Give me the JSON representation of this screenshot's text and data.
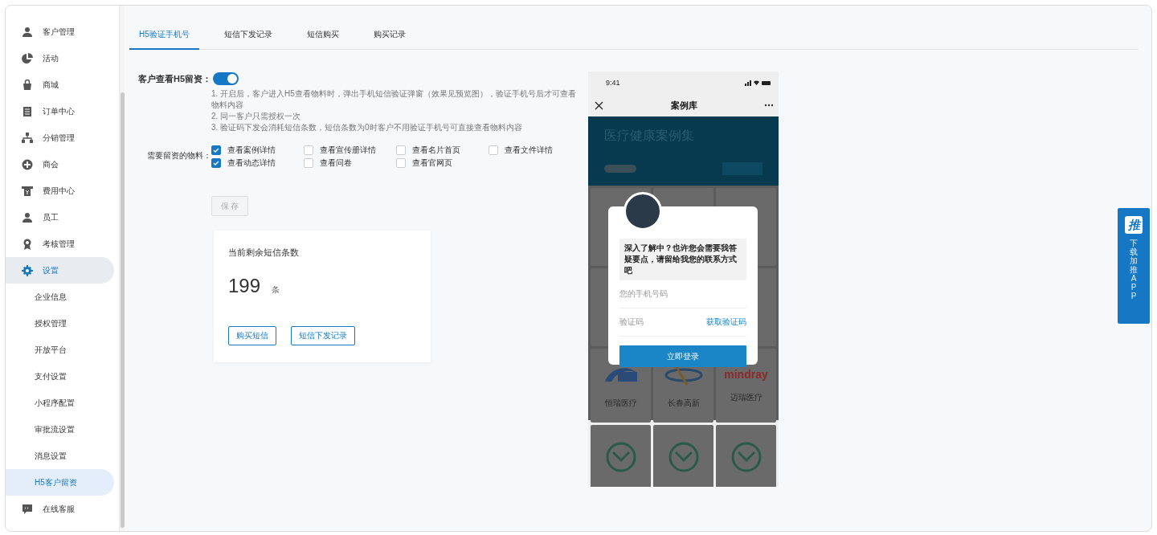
{
  "sidebar": {
    "items": [
      {
        "label": "客户管理",
        "selected": false
      },
      {
        "label": "活动",
        "selected": false
      },
      {
        "label": "商城",
        "selected": false
      },
      {
        "label": "订单中心",
        "selected": false
      },
      {
        "label": "分销管理",
        "selected": false
      },
      {
        "label": "商会",
        "selected": false
      },
      {
        "label": "费用中心",
        "selected": false
      },
      {
        "label": "员工",
        "selected": false
      },
      {
        "label": "考核管理",
        "selected": false
      },
      {
        "label": "设置",
        "selected": true,
        "expanded": true,
        "children": [
          {
            "label": "企业信息",
            "selected": false
          },
          {
            "label": "授权管理",
            "selected": false
          },
          {
            "label": "开放平台",
            "selected": false
          },
          {
            "label": "支付设置",
            "selected": false
          },
          {
            "label": "小程序配置",
            "selected": false
          },
          {
            "label": "审批流设置",
            "selected": false
          },
          {
            "label": "消息设置",
            "selected": false
          },
          {
            "label": "H5客户留资",
            "selected": true
          }
        ]
      },
      {
        "label": "在线客服",
        "selected": false
      }
    ]
  },
  "tabs": [
    {
      "label": "H5验证手机号",
      "selected": true
    },
    {
      "label": "短信下发记录",
      "selected": false
    },
    {
      "label": "短信购买",
      "selected": false
    },
    {
      "label": "购买记录",
      "selected": false
    }
  ],
  "settings": {
    "toggle": {
      "label": "客户查看H5留资：",
      "on": true
    },
    "notes": [
      "1. 开启后，客户进入H5查看物料时，弹出手机短信验证弹窗（效果见预览图），验证手机号后才可查看物料内容",
      "2. 同一客户只需授权一次",
      "3. 验证码下发会消耗短信条数，短信条数为0时客户不用验证手机号可直接查看物料内容"
    ],
    "materials": {
      "label": "需要留资的物料：",
      "options": [
        {
          "label": "查看案例详情",
          "checked": true
        },
        {
          "label": "查看宣传册详情",
          "checked": false
        },
        {
          "label": "查看名片首页",
          "checked": false
        },
        {
          "label": "查看文件详情",
          "checked": false
        },
        {
          "label": "查看动态详情",
          "checked": true
        },
        {
          "label": "查看问卷",
          "checked": false
        },
        {
          "label": "查看官网页",
          "checked": false
        }
      ]
    },
    "save_button": {
      "label": "保 存",
      "disabled": true
    }
  },
  "sms_card": {
    "title": "当前剩余短信条数",
    "count": "199",
    "unit": "条",
    "buttons": [
      "购买短信",
      "短信下发记录"
    ]
  },
  "phone": {
    "time": "9:41",
    "title": "案例库",
    "header": {
      "title": "医疗健康案例集"
    },
    "cases": [
      {
        "label": "恒瑞医疗"
      },
      {
        "label": "长春高新"
      },
      {
        "label": "迈瑞医疗",
        "logo_text": "mindray"
      }
    ],
    "dialog": {
      "message": "深入了解中？也许您会需要我答疑要点，请留给我您的联系方式吧",
      "phone_placeholder": "您的手机号码",
      "code_placeholder": "验证码",
      "code_link": "获取验证码",
      "submit": "立即登录"
    }
  },
  "promo": {
    "icon_text": "推",
    "label": "下载加推APP"
  }
}
